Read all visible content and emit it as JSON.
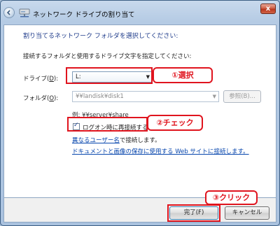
{
  "window": {
    "title": "ネットワーク ドライブの割り当て",
    "close_glyph": "x"
  },
  "header": {
    "heading": "割り当てるネットワーク フォルダを選択してください:",
    "instruction": "接続するフォルダと使用するドライブ文字を指定してください:"
  },
  "drive": {
    "label_pre": "ドライブ(",
    "label_key": "D",
    "label_post": "):",
    "value": "L:",
    "arrow": "▼"
  },
  "folder": {
    "label_pre": "フォルダ(",
    "label_key": "O",
    "label_post": "):",
    "value": "¥¥landisk¥disk1",
    "arrow": "▼",
    "browse_label": "参照(B)..."
  },
  "example_text": "例: ¥¥server¥share",
  "reconnect": {
    "label": "ログオン時に再接続する(R)",
    "checked": true,
    "check_glyph": "✓"
  },
  "links": {
    "other_user": "異なるユーザー名",
    "other_user_suffix": "で接続します。",
    "web_site": "ドキュメントと画像の保存に使用する Web サイトに接続します。"
  },
  "annotations": {
    "select": "①選択",
    "check": "②チェック",
    "click": "③クリック"
  },
  "buttons": {
    "ok": "完了(F)",
    "cancel": "キャンセル"
  },
  "colors": {
    "annotation_red": "#e0141e",
    "heading_blue": "#1e3b8a",
    "link_blue": "#0645ad"
  }
}
